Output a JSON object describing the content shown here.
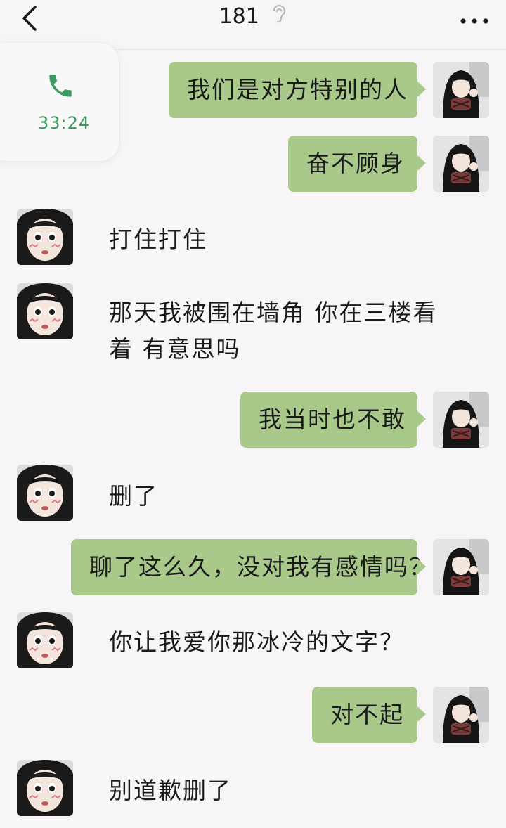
{
  "header": {
    "title": "181"
  },
  "call": {
    "duration": "33:24"
  },
  "messages": [
    {
      "side": "me",
      "text": "我们是对方特别的人"
    },
    {
      "side": "me",
      "text": "奋不顾身"
    },
    {
      "side": "them",
      "text": "打住打住"
    },
    {
      "side": "them",
      "line1": "那天我被围在墙角 你在三楼看",
      "line2": "着 有意思吗"
    },
    {
      "side": "me",
      "text": "我当时也不敢"
    },
    {
      "side": "them",
      "text": "删了"
    },
    {
      "side": "me",
      "text": "聊了这么久，没对我有感情吗？"
    },
    {
      "side": "them",
      "text": "你让我爱你那冰冷的文字？"
    },
    {
      "side": "me",
      "text": "对不起"
    },
    {
      "side": "them",
      "text": "别道歉删了"
    }
  ],
  "colors": {
    "bubble_me": "#a8c98a",
    "background": "#f7f5f7",
    "call_green": "#3d9a5f"
  },
  "icons": {
    "back": "chevron-left-icon",
    "ear": "ear-icon",
    "more": "more-dots-icon",
    "call": "phone-icon"
  }
}
